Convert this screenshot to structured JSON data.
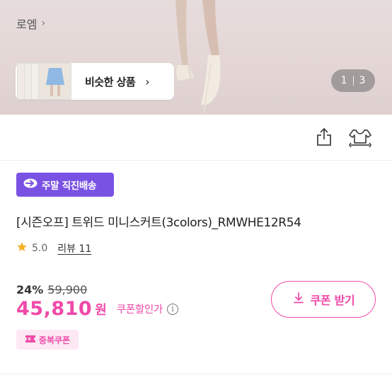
{
  "hero": {
    "similar_label": "비슷한 상품",
    "similar_chevron": "›",
    "pager_current": "1",
    "pager_total": "3"
  },
  "brand": {
    "name": "로엠",
    "chevron": "›"
  },
  "badge": {
    "label": "주말 직진배송"
  },
  "product": {
    "title": "[시즌오프] 트위드 미니스커트(3colors)_RMWHE12R54",
    "rating": "5.0",
    "review_label": "리뷰 11",
    "discount_rate": "24%",
    "original_price": "59,900",
    "price": "45,810",
    "currency": "원",
    "coupon_price_note": "쿠폰할인가",
    "info_glyph": "i"
  },
  "coupon": {
    "button_label": "쿠폰 받기",
    "duplicate_label": "중복쿠폰"
  },
  "colors": {
    "accent_pink": "#ef4aa8",
    "badge_purple": "#7a52e3",
    "star": "#f5b025"
  },
  "icons": [
    "chevron-right-icon",
    "share-icon",
    "closet-icon",
    "delivery-arrow-icon",
    "star-icon",
    "info-icon",
    "download-icon",
    "coupon-icon"
  ]
}
